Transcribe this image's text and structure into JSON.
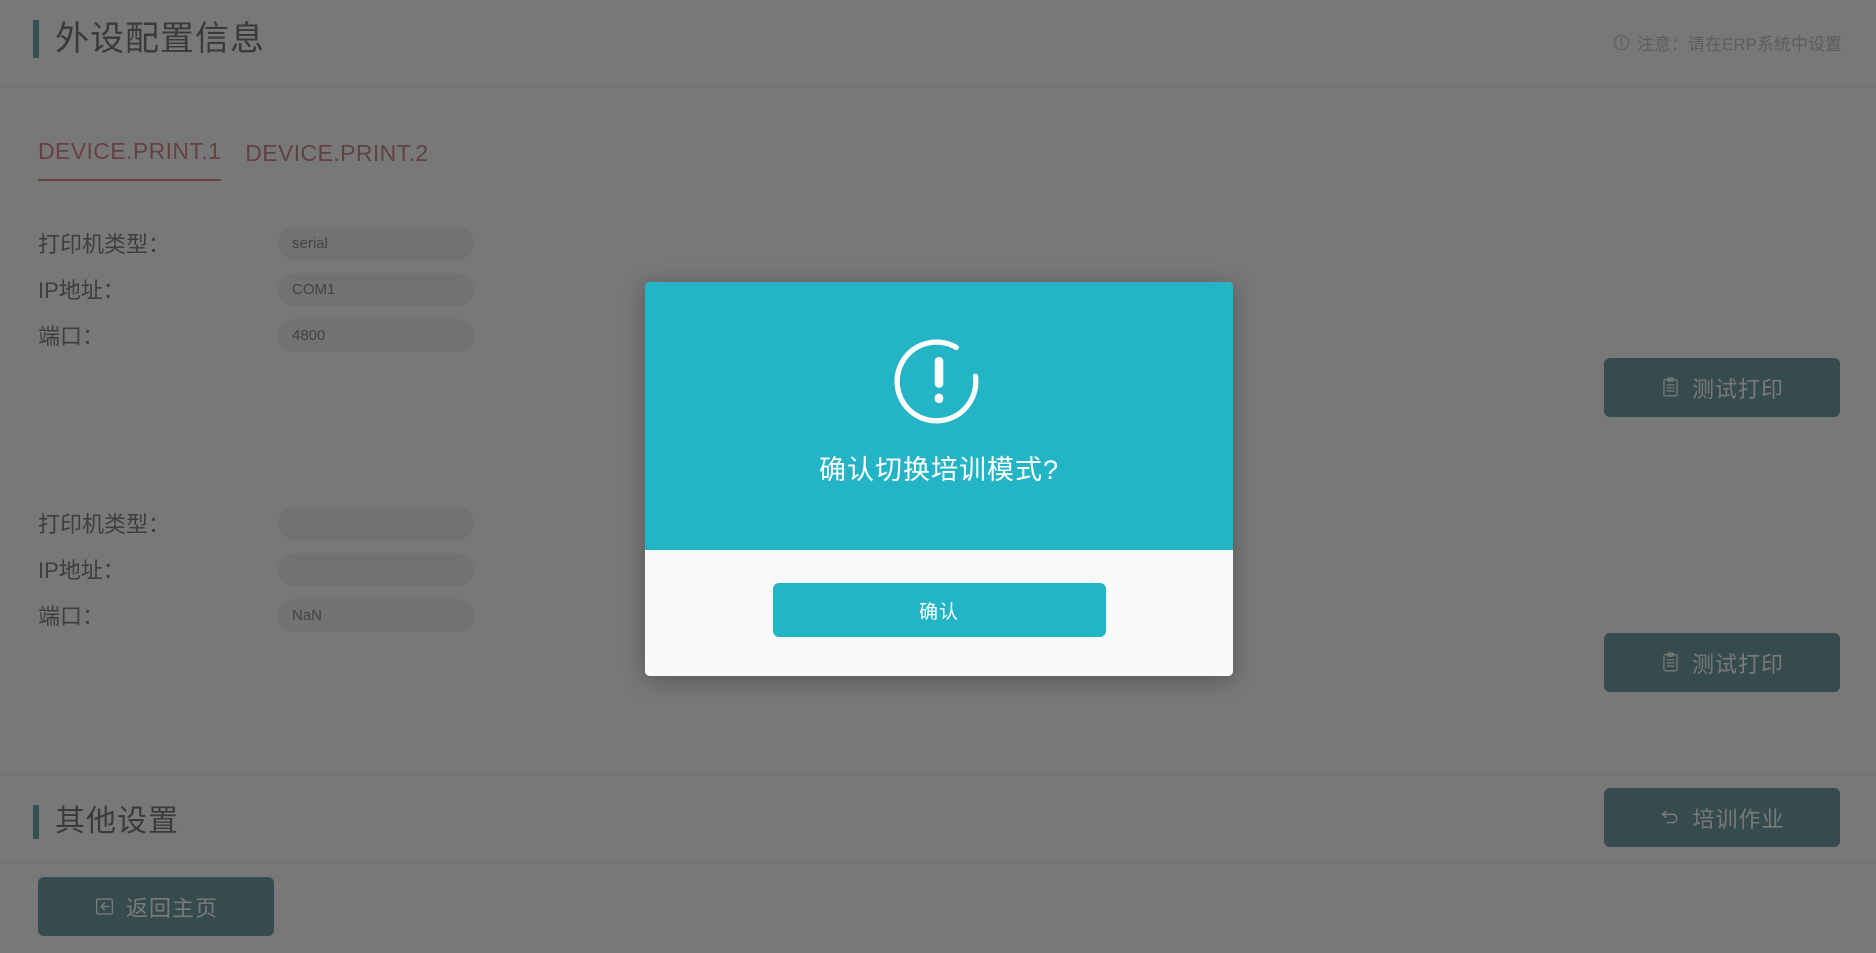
{
  "header": {
    "title": "外设配置信息",
    "note_icon": "exclamation-circle-icon",
    "note": "注意：请在ERP系统中设置"
  },
  "tabs": [
    {
      "label": "DEVICE.PRINT.1",
      "active": true
    },
    {
      "label": "DEVICE.PRINT.2",
      "active": false
    }
  ],
  "printer_groups": [
    {
      "fields": [
        {
          "label": "打印机类型：",
          "value": "serial",
          "placeholder": ""
        },
        {
          "label": "IP地址：",
          "value": "COM1",
          "placeholder": ""
        },
        {
          "label": "端口：",
          "value": "4800",
          "placeholder": ""
        }
      ],
      "test_button": {
        "label": "测试打印",
        "icon": "clipboard-print-icon"
      }
    },
    {
      "fields": [
        {
          "label": "打印机类型：",
          "value": "",
          "placeholder": ""
        },
        {
          "label": "IP地址：",
          "value": "",
          "placeholder": ""
        },
        {
          "label": "端口：",
          "value": "NaN",
          "placeholder": ""
        }
      ],
      "test_button": {
        "label": "测试打印",
        "icon": "clipboard-print-icon"
      }
    }
  ],
  "other_settings": {
    "title": "其他设置",
    "training_button": {
      "label": "培训作业",
      "icon": "undo-arrow-icon"
    },
    "home_button": {
      "label": "返回主页",
      "icon": "enter-box-icon"
    }
  },
  "modal": {
    "icon": "exclamation-circle-icon",
    "message": "确认切换培训模式?",
    "confirm_label": "确认"
  },
  "colors": {
    "accent_teal": "#0b6b6f",
    "button_teal": "#0b5c62",
    "modal_teal": "#23b5c6",
    "tab_active": "#b33b40",
    "page_bg": "#fbfbfb",
    "input_bg": "#e4e4e4",
    "overlay": "rgba(69,69,69,0.72)"
  }
}
